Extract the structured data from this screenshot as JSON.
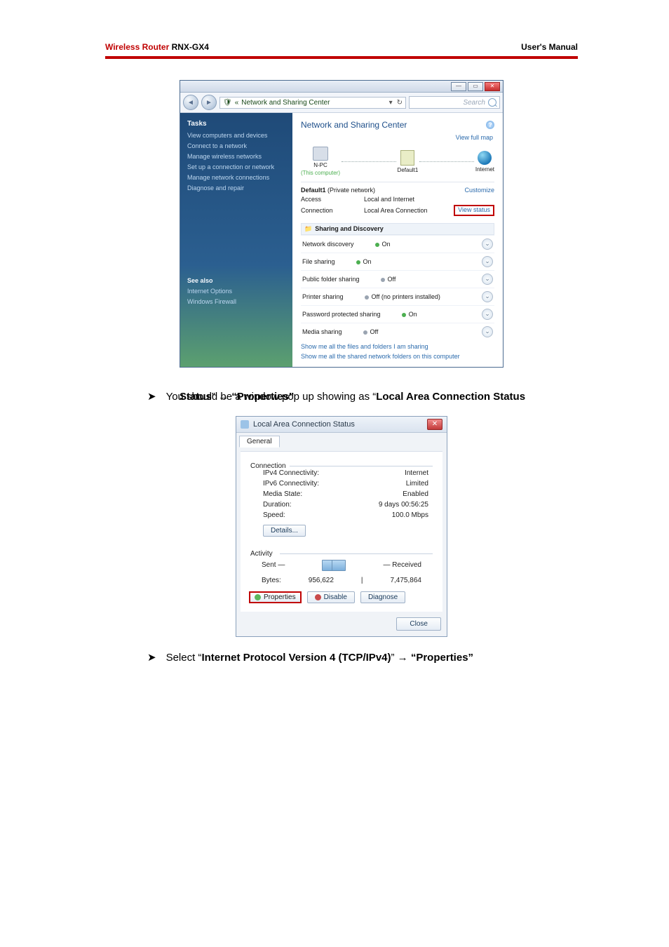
{
  "header": {
    "brand_red": "Wireless Router",
    "brand_model": " RNX-GX4",
    "right": "User's Manual"
  },
  "nsc": {
    "breadcrumb_icon_sep": "«",
    "breadcrumb": "Network and Sharing Center",
    "breadcrumb_dropdown": "▾",
    "search_refresh": "↻",
    "search_placeholder": "Search",
    "tasks_head": "Tasks",
    "tasks": {
      "view_comp": "View computers and devices",
      "connect": "Connect to a network",
      "manage_wireless": "Manage wireless networks",
      "setup": "Set up a connection or network",
      "manage_conn": "Manage network connections",
      "diagnose": "Diagnose and repair"
    },
    "see_also": "See also",
    "see_also_items": {
      "internet_options": "Internet Options",
      "firewall": "Windows Firewall"
    },
    "heading": "Network and Sharing Center",
    "view_full_map": "View full map",
    "node_pc": "N-PC",
    "node_pc_sub": "(This computer)",
    "node_router": "Default1",
    "node_internet": "Internet",
    "default_network_label": "Default1 ",
    "default_network_type": "(Private network)",
    "customize": "Customize",
    "access_k": "Access",
    "access_v": "Local and Internet",
    "connection_k": "Connection",
    "connection_v": "Local Area Connection",
    "view_status": "View status",
    "sharing_head": "Sharing and Discovery",
    "rows": {
      "nd_k": "Network discovery",
      "nd_v": "On",
      "fs_k": "File sharing",
      "fs_v": "On",
      "pf_k": "Public folder sharing",
      "pf_v": "Off",
      "ps_k": "Printer sharing",
      "ps_v": "Off (no printers installed)",
      "pp_k": "Password protected sharing",
      "pp_v": "On",
      "ms_k": "Media sharing",
      "ms_v": "Off"
    },
    "footer1": "Show me all the files and folders I am sharing",
    "footer2": "Show me all the shared network folders on this computer"
  },
  "doc": {
    "bullet_glyph": "➤",
    "line_a": "You should be a window pop up showing as “",
    "line_a_bold": "Local Area Connection Status",
    "line_b_1": "” → ",
    "line_b_bold": "“Properties”"
  },
  "lacs": {
    "title": "Local Area Connection Status",
    "tab_general": "General",
    "group_conn": "Connection",
    "ipv4_k": "IPv4 Connectivity:",
    "ipv4_v": "Internet",
    "ipv6_k": "IPv6 Connectivity:",
    "ipv6_v": "Limited",
    "media_k": "Media State:",
    "media_v": "Enabled",
    "dur_k": "Duration:",
    "dur_v": "9 days 00:56:25",
    "speed_k": "Speed:",
    "speed_v": "100.0 Mbps",
    "details_btn": "Details...",
    "group_act": "Activity",
    "sent": "Sent",
    "dash": "—",
    "received": "Received",
    "bytes_k": "Bytes:",
    "bytes_sent": "956,622",
    "bytes_sep": "|",
    "bytes_recv": "7,475,864",
    "btn_props": "Properties",
    "btn_disable": "Disable",
    "btn_diag": "Diagnose",
    "btn_close": "Close"
  },
  "doc2": {
    "text_a": "Select “",
    "bold1": "Internet Protocol Version 4 (TCP/IPv4)",
    "mid": "” → ",
    "bold2": "“Properties”"
  }
}
